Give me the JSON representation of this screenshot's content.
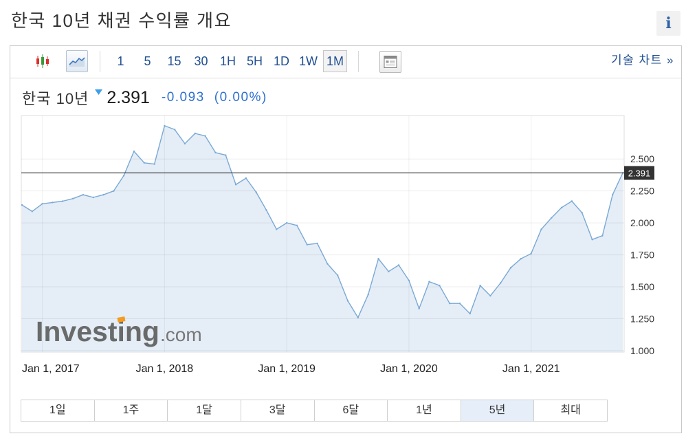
{
  "page": {
    "title": "한국 10년 채권 수익률 개요"
  },
  "info_button": {
    "label": "i",
    "icon": "info-icon"
  },
  "toolbar": {
    "chart_type_buttons": [
      {
        "icon": "candlestick-chart-icon",
        "selected": false
      },
      {
        "icon": "line-chart-icon",
        "selected": true
      }
    ],
    "intervals": [
      {
        "label": "1"
      },
      {
        "label": "5"
      },
      {
        "label": "15"
      },
      {
        "label": "30"
      },
      {
        "label": "1H"
      },
      {
        "label": "5H"
      },
      {
        "label": "1D"
      },
      {
        "label": "1W"
      },
      {
        "label": "1M"
      }
    ],
    "selected_interval": "1M",
    "layout_button_icon": "window-layout-icon",
    "technical_chart_link": "기술 차트 »"
  },
  "quote": {
    "name": "한국 10년",
    "direction_icon": "triangle-down-icon",
    "price": "2.391",
    "change": "-0.093",
    "change_percent": "(0.00%)"
  },
  "watermark": {
    "brand": "Investing",
    "suffix": ".com"
  },
  "range_selector": {
    "items": [
      {
        "label": "1일"
      },
      {
        "label": "1주"
      },
      {
        "label": "1달"
      },
      {
        "label": "3달"
      },
      {
        "label": "6달"
      },
      {
        "label": "1년"
      },
      {
        "label": "5년"
      },
      {
        "label": "최대"
      }
    ],
    "selected": "5년"
  },
  "colors": {
    "link_blue": "#1f4f91",
    "change_blue": "#2f70cf",
    "down_triangle": "#3aa0ec",
    "line": "#79a9d6",
    "area_fill": "#e5edf6",
    "price_line": "#222222",
    "price_label_bg": "#333333",
    "selected_range_bg": "#e6eef9",
    "candle_up": "#3a9a3a",
    "candle_down": "#d9302c"
  },
  "chart_data": {
    "type": "area",
    "x": [
      "2016-11-01",
      "2016-12-01",
      "2017-01-01",
      "2017-02-01",
      "2017-03-01",
      "2017-04-01",
      "2017-05-01",
      "2017-06-01",
      "2017-07-01",
      "2017-08-01",
      "2017-09-01",
      "2017-10-01",
      "2017-11-01",
      "2017-12-01",
      "2018-01-01",
      "2018-02-01",
      "2018-03-01",
      "2018-04-01",
      "2018-05-01",
      "2018-06-01",
      "2018-07-01",
      "2018-08-01",
      "2018-09-01",
      "2018-10-01",
      "2018-11-01",
      "2018-12-01",
      "2019-01-01",
      "2019-02-01",
      "2019-03-01",
      "2019-04-01",
      "2019-05-01",
      "2019-06-01",
      "2019-07-01",
      "2019-08-01",
      "2019-09-01",
      "2019-10-01",
      "2019-11-01",
      "2019-12-01",
      "2020-01-01",
      "2020-02-01",
      "2020-03-01",
      "2020-04-01",
      "2020-05-01",
      "2020-06-01",
      "2020-07-01",
      "2020-08-01",
      "2020-09-01",
      "2020-10-01",
      "2020-11-01",
      "2020-12-01",
      "2021-01-01",
      "2021-02-01",
      "2021-03-01",
      "2021-04-01",
      "2021-05-01",
      "2021-06-01",
      "2021-07-01",
      "2021-08-01",
      "2021-09-01",
      "2021-10-01"
    ],
    "series": [
      {
        "values": [
          2.14,
          2.09,
          2.15,
          2.16,
          2.17,
          2.19,
          2.22,
          2.2,
          2.22,
          2.25,
          2.37,
          2.56,
          2.47,
          2.46,
          2.76,
          2.73,
          2.62,
          2.7,
          2.68,
          2.55,
          2.53,
          2.3,
          2.35,
          2.24,
          2.1,
          1.95,
          2.0,
          1.98,
          1.83,
          1.84,
          1.68,
          1.59,
          1.39,
          1.26,
          1.44,
          1.72,
          1.62,
          1.67,
          1.55,
          1.33,
          1.54,
          1.51,
          1.37,
          1.37,
          1.29,
          1.51,
          1.43,
          1.53,
          1.65,
          1.72,
          1.76,
          1.95,
          2.04,
          2.12,
          2.17,
          2.08,
          1.87,
          1.9,
          2.22,
          2.391
        ]
      }
    ],
    "xlim": [
      "2016-11-01",
      "2021-10-01"
    ],
    "ylim": [
      1.0,
      2.84
    ],
    "x_ticks": [
      {
        "date": "2017-01-01",
        "label": "Jan 1, 2017"
      },
      {
        "date": "2018-01-01",
        "label": "Jan 1, 2018"
      },
      {
        "date": "2019-01-01",
        "label": "Jan 1, 2019"
      },
      {
        "date": "2020-01-01",
        "label": "Jan 1, 2020"
      },
      {
        "date": "2021-01-01",
        "label": "Jan 1, 2021"
      }
    ],
    "y_ticks": [
      {
        "value": 1.0,
        "label": "1.000"
      },
      {
        "value": 1.25,
        "label": "1.250"
      },
      {
        "value": 1.5,
        "label": "1.500"
      },
      {
        "value": 1.75,
        "label": "1.750"
      },
      {
        "value": 2.0,
        "label": "2.000"
      },
      {
        "value": 2.25,
        "label": "2.250"
      },
      {
        "value": 2.5,
        "label": "2.500"
      }
    ],
    "current_value": 2.391,
    "y_axis_position": "right",
    "grid": true
  }
}
